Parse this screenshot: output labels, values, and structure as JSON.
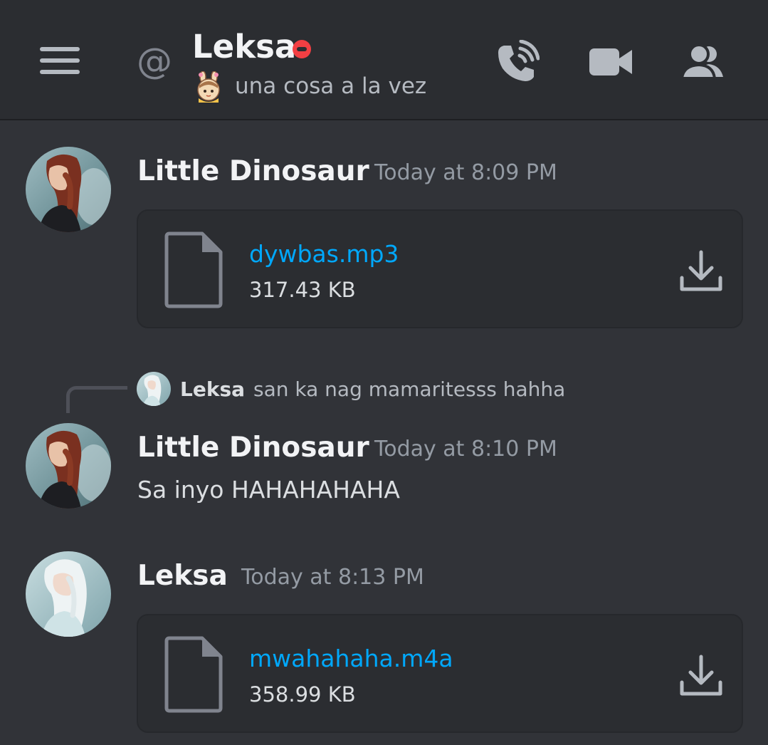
{
  "header": {
    "channel_symbol": "@",
    "name": "Leksa",
    "status_text": "una cosa a la vez",
    "status_emoji": "bunny-girl-emoji",
    "presence": "do-not-disturb",
    "icons": [
      "menu-icon",
      "voice-call-icon",
      "video-call-icon",
      "member-list-icon"
    ]
  },
  "messages": [
    {
      "author": "Little Dinosaur",
      "timestamp": "Today at 8:09 PM",
      "attachment": {
        "name": "dywbas.mp3",
        "size": "317.43 KB"
      }
    },
    {
      "reply": {
        "author": "Leksa",
        "text": "san ka nag mamaritesss hahha"
      },
      "author": "Little Dinosaur",
      "timestamp": "Today at 8:10 PM",
      "text": "Sa inyo HAHAHAHAHA"
    },
    {
      "author": "Leksa",
      "timestamp": "Today at 8:13 PM",
      "attachment": {
        "name": "mwahahaha.m4a",
        "size": "358.99 KB"
      }
    }
  ],
  "colors": {
    "background": "#313338",
    "header": "#2b2d31",
    "link": "#00a8fc",
    "dnd": "#f23f43",
    "muted": "#949ba4"
  }
}
